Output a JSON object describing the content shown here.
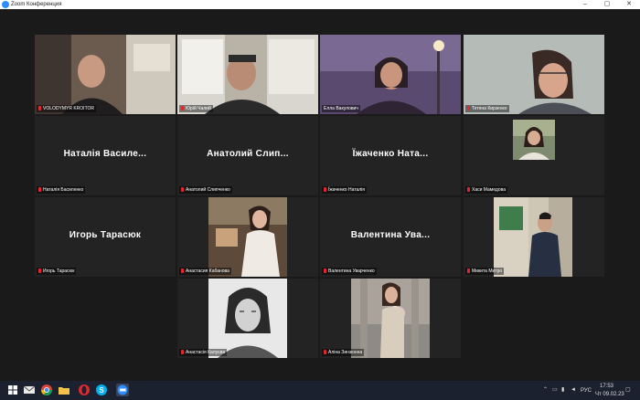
{
  "window": {
    "title": "Zoom Конференция",
    "minimize": "–",
    "maximize": "▢",
    "close": "✕"
  },
  "participants": [
    {
      "label": "VOLODYMYR KROITOR"
    },
    {
      "label": "Юрій Чалий"
    },
    {
      "label": "Елла Вакулович"
    },
    {
      "label": "Тетяна Кирзенко"
    },
    {
      "display_name": "Наталія Василе...",
      "label": "Наталія Басиленко"
    },
    {
      "display_name": "Анатолий Слип...",
      "label": "Анатолий Слипченко"
    },
    {
      "display_name": "Їжаченко Ната...",
      "label": "Їжаченко Наталія"
    },
    {
      "label": "Хаси Мамедова"
    },
    {
      "display_name": "Игорь Тарасюк",
      "label": "Игорь Тарасюк"
    },
    {
      "label": "Анастасия Кабанова"
    },
    {
      "display_name": "Валентина Ува...",
      "label": "Валентина Уварченко"
    },
    {
      "label": "Микита Митро"
    },
    {
      "label": "Анастасія Калуєва"
    },
    {
      "label": "Аліна Зинзюнна"
    }
  ],
  "taskbar": {
    "icons": [
      "windows-icon",
      "mail-icon",
      "chrome-icon",
      "folder-icon",
      "opera-icon",
      "skype-icon",
      "edge-icon",
      "zoom-icon"
    ],
    "language": "РУС",
    "time": "17:53",
    "date": "Чт 09.02.23"
  },
  "colors": {
    "active_speaker": "#e7d37a",
    "muted_mic": "#e0282e",
    "tile_bg": "#232323",
    "taskbar_bg": "#1c2130"
  }
}
